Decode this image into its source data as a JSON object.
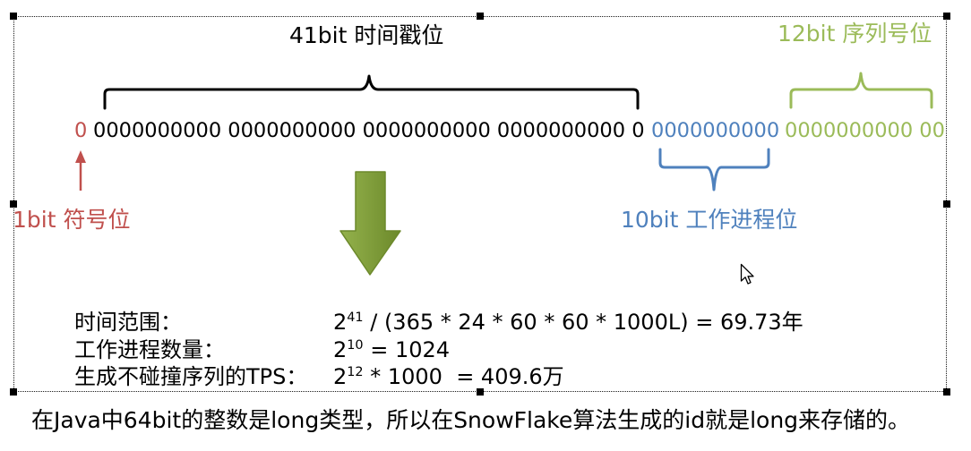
{
  "diagram": {
    "timestamp_label": "41bit 时间戳位",
    "sequence_label": "12bit 序列号位",
    "sign_label": "1bit 符号位",
    "worker_label": "10bit 工作进程位",
    "bits": {
      "sign": "0",
      "timestamp": "0000000000 0000000000 0000000000 0000000000 0",
      "worker": "0000000000",
      "sequence": "0000000000 00"
    },
    "formulas": [
      {
        "label": "时间范围：",
        "base": "2",
        "exponent": "41",
        "rest": " / (365 * 24 * 60 * 60 * 1000L) = 69.73年"
      },
      {
        "label": "工作进程数量：",
        "base": "2",
        "exponent": "10",
        "rest": " = 1024"
      },
      {
        "label": "生成不碰撞序列的TPS：",
        "base": "2",
        "exponent": "12",
        "rest": " * 1000  = 409.6万"
      }
    ]
  },
  "caption": "在Java中64bit的整数是long类型，所以在SnowFlake算法生成的id就是long来存储的。",
  "colors": {
    "sign": "#c0504d",
    "timestamp": "#000000",
    "worker": "#4f81bd",
    "sequence": "#9bbb59",
    "arrow": "#94b24c",
    "arrowdark": "#6c892b",
    "border": "#1a1a1a"
  },
  "icons": {
    "sign_arrow": "up-arrow-icon",
    "conversion_arrow": "down-arrow-icon",
    "pointer": "mouse-pointer-icon"
  }
}
